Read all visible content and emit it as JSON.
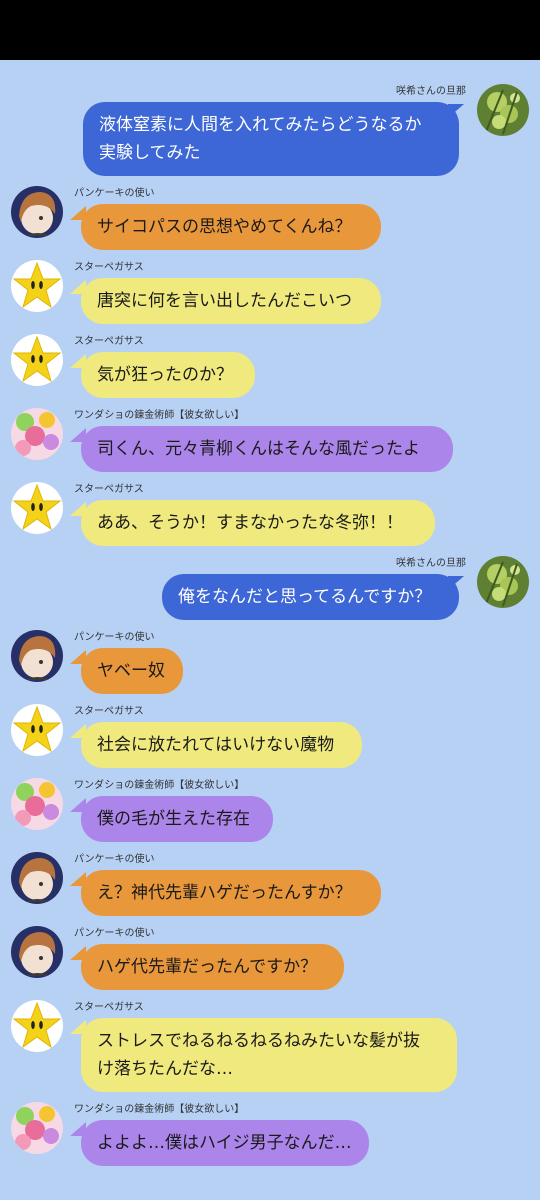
{
  "colors": {
    "background": "#b7d1f5",
    "self_bubble": "#3d66d6",
    "orange_bubble": "#e9973b",
    "yellow_bubble": "#f0ea7e",
    "purple_bubble": "#ac85ea"
  },
  "participants": {
    "self": "咲希さんの旦那",
    "pancake": "パンケーキの使い",
    "star": "スターペガサス",
    "wonder": "ワンダショの錬金術師【彼女欲しい】"
  },
  "messages": [
    {
      "sender": "咲希さんの旦那",
      "text": "液体窒素に人間を入れてみたらどうなるか\n実験してみた"
    },
    {
      "sender": "パンケーキの使い",
      "text": "サイコパスの思想やめてくんね？"
    },
    {
      "sender": "スターペガサス",
      "text": "唐突に何を言い出したんだこいつ"
    },
    {
      "sender": "スターペガサス",
      "text": "気が狂ったのか？"
    },
    {
      "sender": "ワンダショの錬金術師【彼女欲しい】",
      "text": "司くん、元々青柳くんはそんな風だったよ"
    },
    {
      "sender": "スターペガサス",
      "text": "ああ、そうか！すまなかったな冬弥！！"
    },
    {
      "sender": "咲希さんの旦那",
      "text": "俺をなんだと思ってるんですか？"
    },
    {
      "sender": "パンケーキの使い",
      "text": "ヤベー奴"
    },
    {
      "sender": "スターペガサス",
      "text": "社会に放たれてはいけない魔物"
    },
    {
      "sender": "ワンダショの錬金術師【彼女欲しい】",
      "text": "僕の毛が生えた存在"
    },
    {
      "sender": "パンケーキの使い",
      "text": "え？神代先輩ハゲだったんすか？"
    },
    {
      "sender": "パンケーキの使い",
      "text": "ハゲ代先輩だったんですか？"
    },
    {
      "sender": "スターペガサス",
      "text": "ストレスでねるねるねるねみたいな髪が抜\nけ落ちたんだな…"
    },
    {
      "sender": "ワンダショの錬金術師【彼女欲しい】",
      "text": "よよよ…僕はハイジ男子なんだ…"
    }
  ]
}
